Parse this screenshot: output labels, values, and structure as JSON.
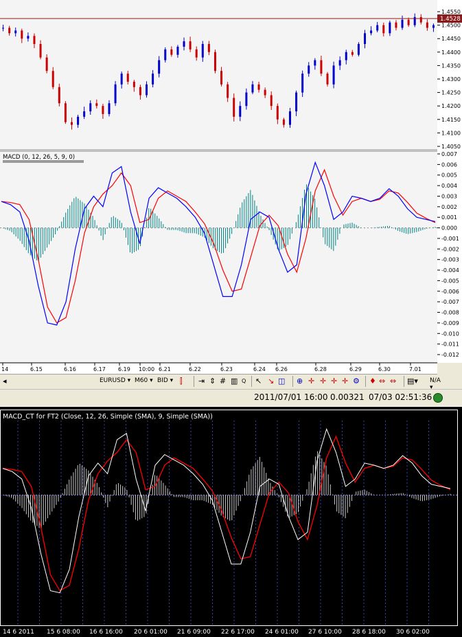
{
  "chart_data": [
    {
      "type": "candlestick",
      "title": "",
      "price_label": "1.4528",
      "ylim": [
        1.405,
        1.455
      ],
      "y_ticks": [
        "1.4550",
        "1.4500",
        "1.4450",
        "1.4400",
        "1.4350",
        "1.4300",
        "1.4250",
        "1.4200",
        "1.4150",
        "1.4100",
        "1.4050"
      ],
      "close_series": [
        1.449,
        1.447,
        1.448,
        1.445,
        1.446,
        1.443,
        1.438,
        1.433,
        1.427,
        1.421,
        1.414,
        1.413,
        1.416,
        1.418,
        1.421,
        1.42,
        1.417,
        1.421,
        1.428,
        1.432,
        1.429,
        1.427,
        1.424,
        1.428,
        1.432,
        1.437,
        1.441,
        1.439,
        1.442,
        1.444,
        1.441,
        1.438,
        1.443,
        1.44,
        1.433,
        1.428,
        1.423,
        1.416,
        1.42,
        1.425,
        1.428,
        1.426,
        1.424,
        1.42,
        1.415,
        1.413,
        1.418,
        1.425,
        1.432,
        1.435,
        1.437,
        1.432,
        1.428,
        1.435,
        1.437,
        1.44,
        1.439,
        1.443,
        1.447,
        1.448,
        1.45,
        1.447,
        1.451,
        1.449,
        1.452,
        1.45,
        1.453,
        1.451,
        1.449,
        1.45
      ]
    },
    {
      "type": "macd",
      "title": "MACD (0, 12, 26, 5, 9, 0)",
      "ylim": [
        -0.012,
        0.007
      ],
      "y_ticks": [
        "0.007",
        "0.006",
        "0.005",
        "0.004",
        "0.003",
        "0.002",
        "0.001",
        "0.000",
        "-0.001",
        "-0.002",
        "-0.003",
        "-0.004",
        "-0.005",
        "-0.006",
        "-0.007",
        "-0.008",
        "-0.009",
        "-0.010",
        "-0.011",
        "-0.012"
      ],
      "x_tick_labels": [
        "14",
        "6.15",
        "6.16",
        "6.17",
        "6.19",
        "10:00",
        "6.21",
        "6.22",
        "6.23",
        "6.24",
        "6.26",
        "6.28",
        "6.29",
        "6.30",
        "7.01"
      ],
      "macd_series": [
        0.0025,
        0.0022,
        0.0015,
        -0.0012,
        -0.0055,
        -0.009,
        -0.0092,
        -0.007,
        -0.002,
        0.0018,
        0.003,
        0.002,
        0.0052,
        0.0058,
        0.0015,
        -0.0015,
        0.0028,
        0.0038,
        0.0033,
        0.0028,
        0.002,
        0.001,
        -0.0005,
        -0.0035,
        -0.0065,
        -0.0065,
        -0.0035,
        0.0008,
        0.0015,
        0.001,
        -0.002,
        -0.0042,
        -0.0035,
        0.0032,
        0.0062,
        0.004,
        0.0008,
        0.0015,
        0.003,
        0.0028,
        0.0025,
        0.0028,
        0.0037,
        0.003,
        0.0018,
        0.001,
        0.0008,
        0.0006
      ],
      "signal_series": [
        0.0025,
        0.0024,
        0.0022,
        0.0008,
        -0.003,
        -0.0075,
        -0.009,
        -0.0085,
        -0.005,
        -0.0005,
        0.002,
        0.0032,
        0.004,
        0.0052,
        0.004,
        0.0005,
        0.0008,
        0.0028,
        0.0035,
        0.003,
        0.0025,
        0.0015,
        0.0004,
        -0.0015,
        -0.004,
        -0.006,
        -0.0058,
        -0.0028,
        0.0002,
        0.0012,
        0.0002,
        -0.0025,
        -0.0042,
        -0.001,
        0.0035,
        0.0055,
        0.003,
        0.0012,
        0.0025,
        0.0028,
        0.0025,
        0.0027,
        0.0035,
        0.0033,
        0.0024,
        0.0014,
        0.0009,
        0.0005
      ],
      "histogram_series": [
        0.0,
        -0.0003,
        -0.0012,
        -0.0025,
        -0.0032,
        -0.0018,
        -0.0004,
        0.0015,
        0.003,
        0.0023,
        0.001,
        -0.0012,
        0.0012,
        0.0006,
        -0.0025,
        -0.002,
        0.002,
        0.001,
        -0.0002,
        -0.0002,
        -0.0005,
        -0.0005,
        -0.0009,
        -0.002,
        -0.0025,
        -0.0005,
        0.0023,
        0.0036,
        0.0013,
        -0.0002,
        -0.0022,
        -0.0017,
        0.0007,
        0.0042,
        0.0027,
        -0.0015,
        -0.0022,
        0.0003,
        0.0005,
        0.0,
        0.0,
        0.0001,
        0.0002,
        -0.0003,
        -0.0006,
        -0.0004,
        -0.0001,
        0.0001
      ],
      "colors": {
        "macd": "#0000ff",
        "signal": "#ff0000",
        "histogram": "#008080"
      }
    },
    {
      "type": "macd",
      "title": "MACD_CT for FT2 (Close, 12, 26, Simple (SMA), 9, Simple (SMA))",
      "x_tick_labels": [
        "14 6 2011",
        "15 6 08:00",
        "16 6 16:00",
        "20 6 01:00",
        "21 6 09:00",
        "22 6 17:00",
        "24 6 01:00",
        "27 6 10:00",
        "28 6 18:00",
        "30 6 02:00"
      ],
      "colors": {
        "macd": "#ffffff",
        "signal": "#ff0000",
        "histogram": "#c8c8c8"
      }
    }
  ],
  "toolbar": {
    "symbol": "EURUSD ▾",
    "timeframe": "M60 ▾",
    "side": "BID ▾"
  },
  "status": {
    "datetime": "2011/07/01 16:00",
    "value": "0.00321",
    "clock": "07/03 02:51:36"
  }
}
